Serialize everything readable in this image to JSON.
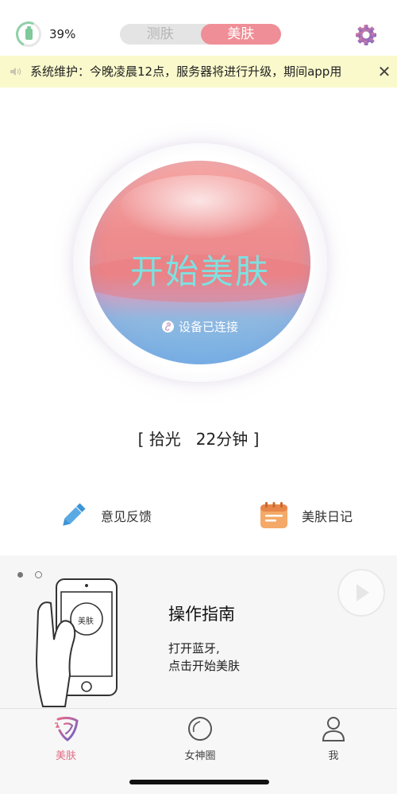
{
  "header": {
    "battery_percent": "39%",
    "battery_level": 0.39,
    "mode_tabs": [
      {
        "label": "测肤",
        "active": false
      },
      {
        "label": "美肤",
        "active": true
      }
    ],
    "settings_icon": "gear-icon"
  },
  "notice": {
    "speaker_icon": "speaker-icon",
    "text": "系统维护：今晚凌晨12点，服务器将进行升级，期间app用",
    "close_icon": "close-icon"
  },
  "orb": {
    "title": "开始美肤",
    "status": "设备已连接",
    "status_icon": "link-icon"
  },
  "mode_info": "[ 拾光   22分钟 ]",
  "actions": {
    "feedback": {
      "label": "意见反馈",
      "icon": "pencil-icon"
    },
    "diary": {
      "label": "美肤日记",
      "icon": "calendar-icon"
    }
  },
  "guide": {
    "title": "操作指南",
    "desc_line1": "打开蓝牙,",
    "desc_line2": "点击开始美肤",
    "phone_button_label": "美肤",
    "play_icon": "play-icon"
  },
  "tabbar": {
    "items": [
      {
        "label": "美肤",
        "icon": "face-icon",
        "active": true
      },
      {
        "label": "女神圈",
        "icon": "circle-icon",
        "active": false
      },
      {
        "label": "我",
        "icon": "user-icon",
        "active": false
      }
    ]
  },
  "colors": {
    "accent_pink": "#ef8e96",
    "active_tab": "#e26f86",
    "orb_title": "#7ee0e0",
    "notice_bg": "#f9f9cc"
  }
}
